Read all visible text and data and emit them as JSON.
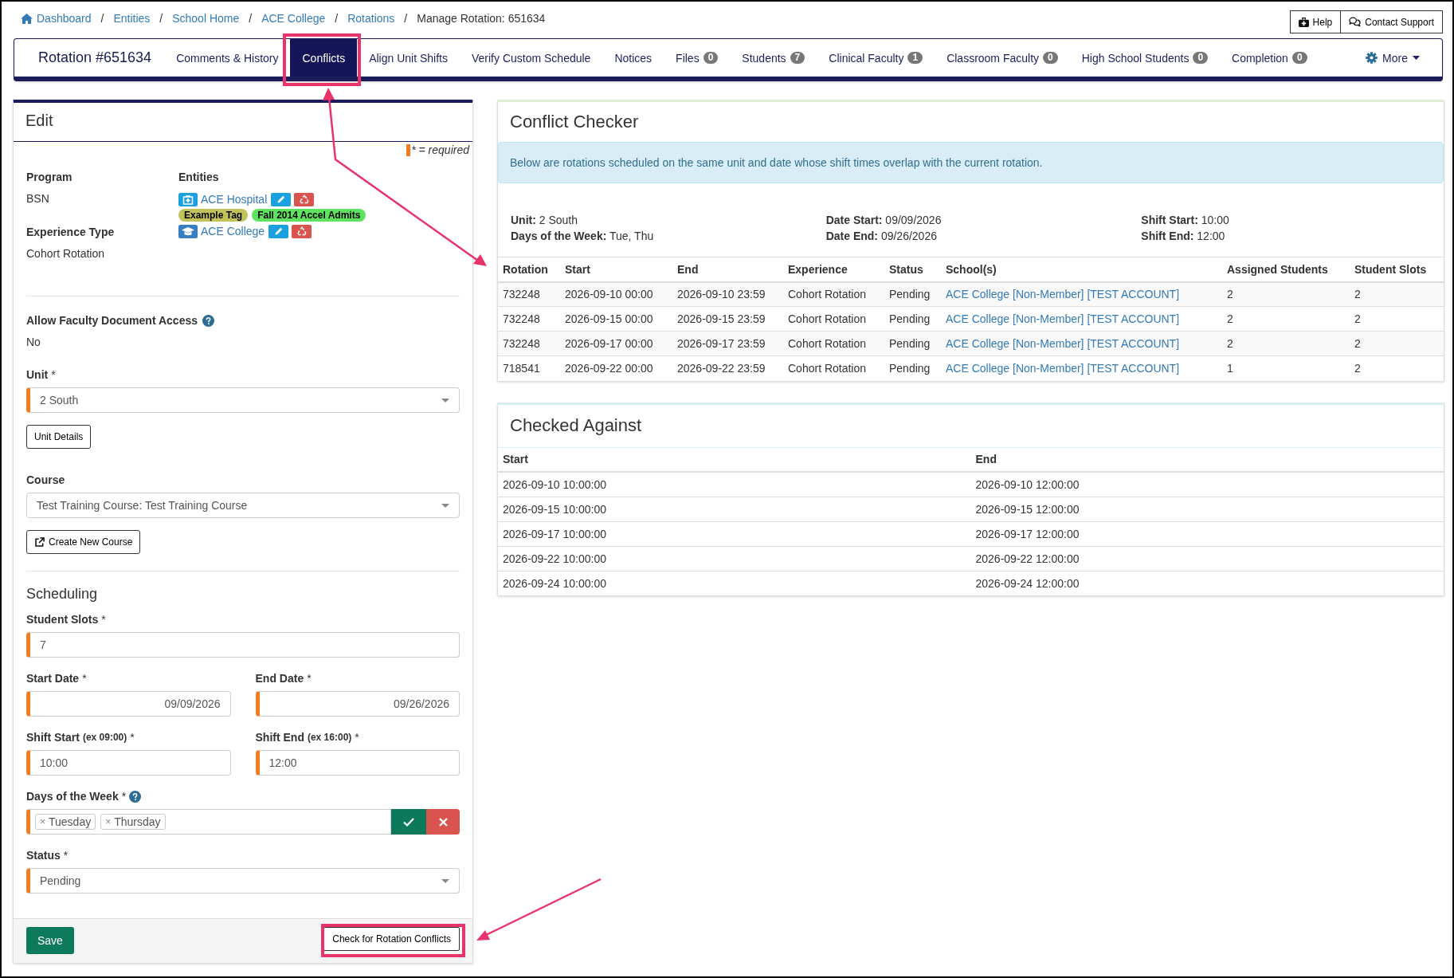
{
  "breadcrumbs": {
    "separator": "/",
    "items": [
      {
        "label": "Dashboard",
        "kind": "link"
      },
      {
        "label": "Entities",
        "kind": "link"
      },
      {
        "label": "School Home",
        "kind": "link"
      },
      {
        "label": "ACE College",
        "kind": "link"
      },
      {
        "label": "Rotations",
        "kind": "link"
      },
      {
        "label": "Manage Rotation: 651634",
        "kind": "current"
      }
    ]
  },
  "header_buttons": [
    {
      "label": "Help",
      "kind": "help"
    },
    {
      "label": "Contact Support",
      "kind": "support"
    }
  ],
  "nav": {
    "title": "Rotation #651634",
    "tabs": [
      {
        "label": "Comments & History",
        "selected": false
      },
      {
        "label": "Conflicts",
        "selected": true
      },
      {
        "label": "Align Unit Shifts",
        "selected": false
      },
      {
        "label": "Verify Custom Schedule",
        "selected": false
      },
      {
        "label": "Notices",
        "selected": false
      },
      {
        "label": "Files",
        "count": "0",
        "selected": false
      },
      {
        "label": "Students",
        "count": "7",
        "selected": false
      },
      {
        "label": "Clinical Faculty",
        "count": "1",
        "selected": false
      },
      {
        "label": "Classroom Faculty",
        "count": "0",
        "selected": false
      },
      {
        "label": "High School Students",
        "count": "0",
        "selected": false
      },
      {
        "label": "Completion",
        "count": "0",
        "selected": false
      }
    ],
    "more": "More"
  },
  "edit": {
    "title": "Edit",
    "required_note": "* = required",
    "program": {
      "label": "Program",
      "value": "BSN"
    },
    "experience_type": {
      "label": "Experience Type",
      "value": "Cohort Rotation"
    },
    "entities": {
      "label": "Entities",
      "items": [
        {
          "kind": "hospital",
          "name": "ACE Hospital",
          "tags": [
            {
              "label": "Example Tag",
              "color": "#c2c25a"
            },
            {
              "label": "Fall 2014 Accel Admits",
              "color": "#5fe25f"
            }
          ]
        },
        {
          "kind": "school",
          "name": "ACE College"
        }
      ]
    },
    "faculty_access": {
      "label": "Allow Faculty Document Access",
      "help": true,
      "value": "No"
    },
    "form": [
      {
        "kind": "select",
        "label": "Unit",
        "mark": "*",
        "required": true,
        "value": "2 South",
        "button": {
          "label": "Unit Details",
          "kind": "plain"
        }
      },
      {
        "kind": "select",
        "label": "Course",
        "required": false,
        "value": "Test Training Course: Test Training Course",
        "button": {
          "label": "Create New Course",
          "kind": "external"
        }
      },
      {
        "kind": "heading",
        "label": "Scheduling"
      },
      {
        "kind": "input",
        "label": "Student Slots",
        "mark": "*",
        "required": true,
        "value": "7"
      },
      {
        "kind": "pair",
        "items": [
          {
            "kind": "date",
            "label": "Start Date",
            "mark": "*",
            "required": true,
            "value": "09/09/2026"
          },
          {
            "kind": "date",
            "label": "End Date",
            "mark": "*",
            "required": true,
            "value": "09/26/2026"
          }
        ]
      },
      {
        "kind": "pair",
        "items": [
          {
            "kind": "input",
            "label": "Shift Start",
            "hint": "(ex 09:00)",
            "mark": "*",
            "required": true,
            "value": "10:00"
          },
          {
            "kind": "input",
            "label": "Shift End",
            "hint": "(ex 16:00)",
            "mark": "*",
            "required": true,
            "value": "12:00"
          }
        ]
      },
      {
        "kind": "tags",
        "label": "Days of the Week",
        "mark": "*",
        "help": true,
        "required": true,
        "tags": [
          {
            "remove": "×",
            "label": "Tuesday"
          },
          {
            "remove": "×",
            "label": "Thursday"
          }
        ]
      },
      {
        "kind": "select",
        "label": "Status",
        "mark": "*",
        "required": true,
        "value": "Pending"
      }
    ],
    "buttons": [
      {
        "label": "Save",
        "kind": "primary"
      },
      {
        "label": "Check for Rotation Conflicts",
        "kind": "default"
      }
    ]
  },
  "conflict_checker": {
    "title": "Conflict Checker",
    "notice": "Below are rotations scheduled on the same unit and date whose shift times overlap with the current rotation.",
    "summary": [
      [
        {
          "label": "Unit:",
          "value": "2 South"
        },
        {
          "label": "Days of the Week:",
          "value": "Tue, Thu"
        }
      ],
      [
        {
          "label": "Date Start:",
          "value": "09/09/2026"
        },
        {
          "label": "Date End:",
          "value": "09/26/2026"
        }
      ],
      [
        {
          "label": "Shift Start:",
          "value": "10:00"
        },
        {
          "label": "Shift End:",
          "value": "12:00"
        }
      ]
    ],
    "columns": [
      {
        "label": "Rotation",
        "kind": "text"
      },
      {
        "label": "Start",
        "kind": "text"
      },
      {
        "label": "End",
        "kind": "text"
      },
      {
        "label": "Experience",
        "kind": "text"
      },
      {
        "label": "Status",
        "kind": "text"
      },
      {
        "label": "School(s)",
        "kind": "link"
      },
      {
        "label": "Assigned Students",
        "kind": "text"
      },
      {
        "label": "Student Slots",
        "kind": "text"
      }
    ],
    "rows": [
      [
        "732248",
        "2026-09-10 00:00",
        "2026-09-10 23:59",
        "Cohort Rotation",
        "Pending",
        "ACE College [Non-Member] [TEST ACCOUNT]",
        "2",
        "2"
      ],
      [
        "732248",
        "2026-09-15 00:00",
        "2026-09-15 23:59",
        "Cohort Rotation",
        "Pending",
        "ACE College [Non-Member] [TEST ACCOUNT]",
        "2",
        "2"
      ],
      [
        "732248",
        "2026-09-17 00:00",
        "2026-09-17 23:59",
        "Cohort Rotation",
        "Pending",
        "ACE College [Non-Member] [TEST ACCOUNT]",
        "2",
        "2"
      ],
      [
        "718541",
        "2026-09-22 00:00",
        "2026-09-22 23:59",
        "Cohort Rotation",
        "Pending",
        "ACE College [Non-Member] [TEST ACCOUNT]",
        "1",
        "2"
      ]
    ]
  },
  "checked_against": {
    "title": "Checked Against",
    "columns": [
      "Start",
      "End"
    ],
    "rows": [
      [
        "2026-09-10 10:00:00",
        "2026-09-10 12:00:00"
      ],
      [
        "2026-09-15 10:00:00",
        "2026-09-15 12:00:00"
      ],
      [
        "2026-09-17 10:00:00",
        "2026-09-17 12:00:00"
      ],
      [
        "2026-09-22 10:00:00",
        "2026-09-22 12:00:00"
      ],
      [
        "2026-09-24 10:00:00",
        "2026-09-24 12:00:00"
      ]
    ]
  }
}
